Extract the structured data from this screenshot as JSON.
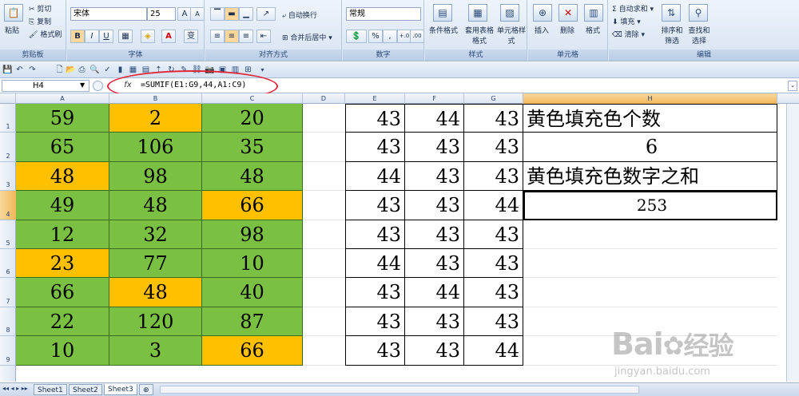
{
  "ribbon": {
    "clipboard": {
      "paste": "粘贴",
      "cut": "剪切",
      "copy": "复制",
      "format_painter": "格式刷",
      "label": "剪贴板"
    },
    "font": {
      "name": "宋体",
      "size": "25",
      "bold": "B",
      "italic": "I",
      "underline": "U",
      "grow": "A",
      "shrink": "A",
      "font_color": "A",
      "phonetic": "变",
      "label": "字体"
    },
    "alignment": {
      "wrap": "自动换行",
      "merge": "合并后居中",
      "label": "对齐方式"
    },
    "number": {
      "format": "常规",
      "percent": "%",
      "comma": ",",
      "inc": "+.0",
      "dec": ".00",
      "label": "数字"
    },
    "styles": {
      "conditional": "条件格式",
      "table": "套用表格格式",
      "cell": "单元格样式",
      "label": "样式"
    },
    "cells": {
      "insert": "插入",
      "delete": "删除",
      "format": "格式",
      "label": "单元格"
    },
    "editing": {
      "autosum": "自动求和",
      "fill": "填充",
      "clear": "清除",
      "sort": "排序和筛选",
      "find": "查找和选择",
      "label": "编辑"
    }
  },
  "formula_bar": {
    "cell_ref": "H4",
    "fx": "fx",
    "formula": "=SUMIF(E1:G9,44,A1:C9)"
  },
  "columns": [
    "A",
    "B",
    "C",
    "D",
    "E",
    "F",
    "G",
    "H"
  ],
  "rows": [
    "1",
    "2",
    "3",
    "4",
    "5",
    "6",
    "7",
    "8",
    "9"
  ],
  "grid_abc": [
    [
      "59",
      "2",
      "20"
    ],
    [
      "65",
      "106",
      "35"
    ],
    [
      "48",
      "98",
      "48"
    ],
    [
      "49",
      "48",
      "66"
    ],
    [
      "12",
      "32",
      "98"
    ],
    [
      "23",
      "77",
      "10"
    ],
    [
      "66",
      "48",
      "40"
    ],
    [
      "22",
      "120",
      "87"
    ],
    [
      "10",
      "3",
      "66"
    ]
  ],
  "fill_abc": [
    [
      "g",
      "y",
      "g"
    ],
    [
      "g",
      "g",
      "g"
    ],
    [
      "y",
      "g",
      "g"
    ],
    [
      "g",
      "g",
      "y"
    ],
    [
      "g",
      "g",
      "g"
    ],
    [
      "y",
      "g",
      "g"
    ],
    [
      "g",
      "y",
      "g"
    ],
    [
      "g",
      "g",
      "g"
    ],
    [
      "g",
      "g",
      "y"
    ]
  ],
  "grid_efg": [
    [
      "43",
      "44",
      "43"
    ],
    [
      "43",
      "43",
      "43"
    ],
    [
      "44",
      "43",
      "43"
    ],
    [
      "43",
      "43",
      "44"
    ],
    [
      "43",
      "43",
      "43"
    ],
    [
      "44",
      "43",
      "43"
    ],
    [
      "43",
      "44",
      "43"
    ],
    [
      "43",
      "43",
      "43"
    ],
    [
      "43",
      "43",
      "44"
    ]
  ],
  "col_h": [
    "黄色填充色个数",
    "6",
    "黄色填充色数字之和",
    "253"
  ],
  "colors": {
    "green": "#7ac143",
    "yellow": "#ffc000",
    "highlight": "#e0283a"
  },
  "sheets": [
    "Sheet1",
    "Sheet2",
    "Sheet3"
  ],
  "watermark": {
    "brand": "Bai",
    "brand2": "经验",
    "url": "jingyan.baidu.com"
  }
}
